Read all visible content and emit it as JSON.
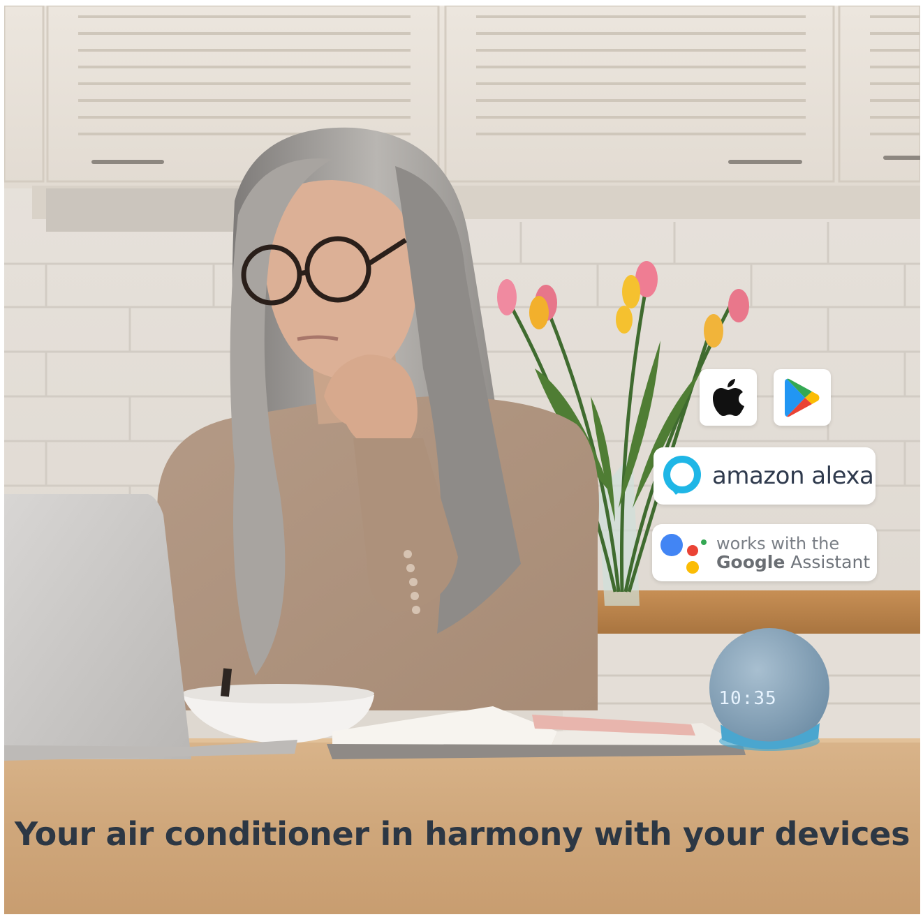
{
  "app_badges": {
    "apple_icon": "apple-logo-icon",
    "play_icon": "google-play-icon"
  },
  "alexa": {
    "icon": "alexa-ring-icon",
    "label": "amazon alexa",
    "color": "#1fb6e6"
  },
  "google_assistant": {
    "icon": "google-assistant-dots-icon",
    "line1": "works with the",
    "brand": "Google",
    "suffix": " Assistant",
    "colors": [
      "#4285f4",
      "#ea4335",
      "#fbbc04",
      "#34a853"
    ]
  },
  "speaker": {
    "clock_text": "10:35"
  },
  "headline": "Your air conditioner in harmony with your devices"
}
